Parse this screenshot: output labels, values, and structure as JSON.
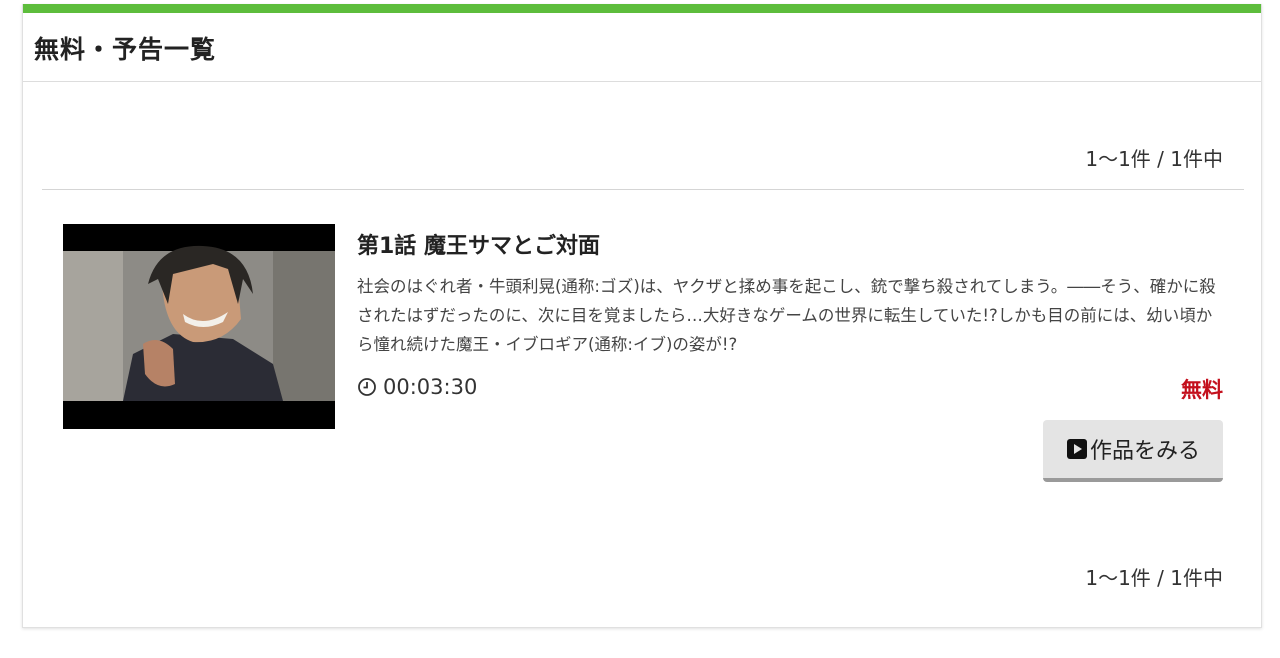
{
  "section": {
    "title": "無料・予告一覧"
  },
  "pagination": {
    "top_text": "1〜1件 /  1件中",
    "bottom_text": "1〜1件 /  1件中"
  },
  "episodes": [
    {
      "title": "第1話 魔王サマとご対面",
      "description": "社会のはぐれ者・牛頭利晃(通称:ゴズ)は、ヤクザと揉め事を起こし、銃で撃ち殺されてしまう。――そう、確かに殺されたはずだったのに、次に目を覚ましたら…大好きなゲームの世界に転生していた!?しかも目の前には、幼い頃から憧れ続けた魔王・イブロギア(通称:イブ)の姿が!?",
      "duration": "00:03:30",
      "price_label": "無料",
      "watch_button_label": "作品をみる",
      "thumbnail_alt": "episode-thumbnail"
    }
  ],
  "icons": {
    "clock": "clock-icon",
    "play": "play-icon"
  },
  "colors": {
    "accent_bar": "#5dbd3c",
    "free_label": "#c4101d",
    "button_bg": "#e4e4e4"
  }
}
